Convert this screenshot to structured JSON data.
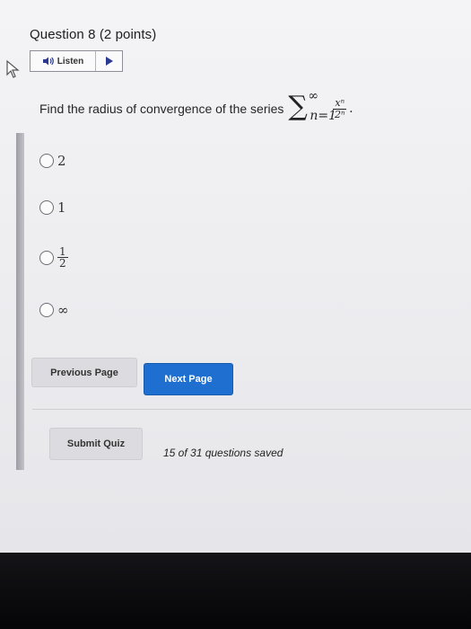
{
  "question": {
    "title": "Question 8 (2 points)",
    "listen_label": "Listen",
    "prompt": "Find the radius of convergence of the series",
    "series": {
      "sigma": "∑",
      "upper": "∞",
      "lower": "n=1",
      "numerator": "xⁿ",
      "denominator": "2ⁿ",
      "terminator": "."
    }
  },
  "options": [
    {
      "label": "2"
    },
    {
      "label": "1"
    },
    {
      "numerator": "1",
      "denominator": "2"
    },
    {
      "label": "∞"
    }
  ],
  "navigation": {
    "previous": "Previous Page",
    "next": "Next Page",
    "submit": "Submit Quiz"
  },
  "status": "15 of 31 questions saved",
  "colors": {
    "next_button": "#1f6fd0",
    "play_icon": "#2b3a8f"
  },
  "icons": [
    "speaker-icon",
    "play-icon",
    "cursor-pointer-icon"
  ]
}
